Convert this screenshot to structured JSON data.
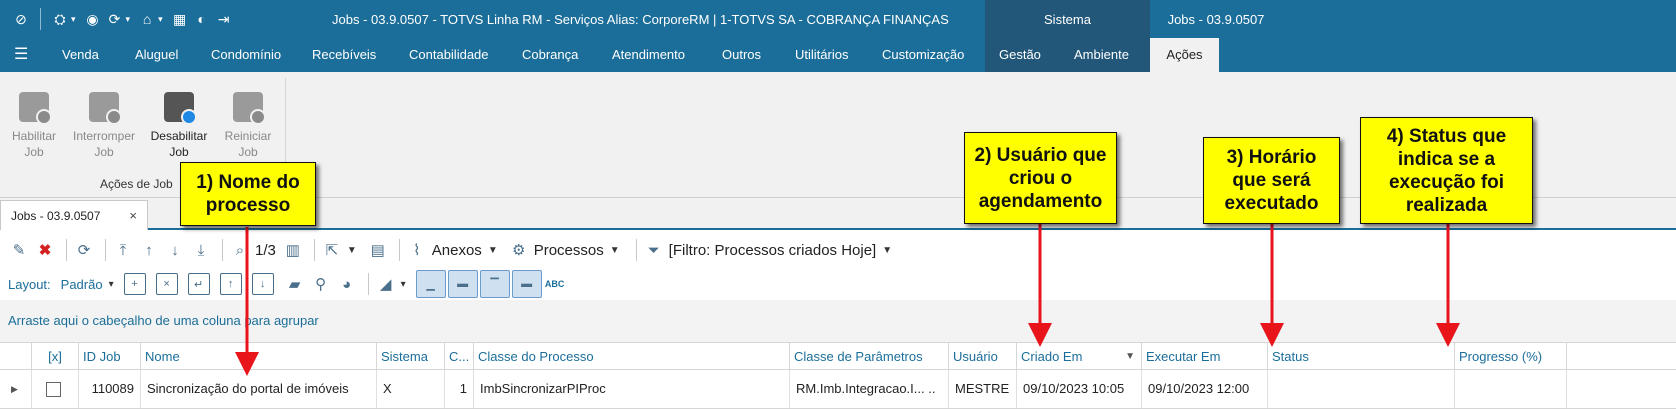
{
  "titlebar": {
    "title": "Jobs - 03.9.0507 - TOTVS Linha RM - Serviços  Alias: CorporeRM | 1-TOTVS SA - COBRANÇA FINANÇAS",
    "ctx_sistema": "Sistema",
    "ctx_jobs": "Jobs - 03.9.0507"
  },
  "menu": {
    "items": [
      "Venda",
      "Aluguel",
      "Condomínio",
      "Recebíveis",
      "Contabilidade",
      "Cobrança",
      "Atendimento",
      "Outros",
      "Utilitários",
      "Customização",
      "Gestão",
      "Ambiente",
      "Ações"
    ]
  },
  "ribbon": {
    "buttons": [
      {
        "line1": "Habilitar",
        "line2": "Job"
      },
      {
        "line1": "Interromper",
        "line2": "Job"
      },
      {
        "line1": "Desabilitar",
        "line2": "Job"
      },
      {
        "line1": "Reiniciar",
        "line2": "Job"
      }
    ],
    "group_label": "Ações de Job"
  },
  "doc_tab": {
    "label": "Jobs - 03.9.0507",
    "close": "×"
  },
  "toolbar": {
    "page": "1/3",
    "anexos": "Anexos",
    "processos": "Processos",
    "filtro": "[Filtro: Processos criados Hoje]"
  },
  "toolbar2": {
    "layout_label": "Layout:",
    "layout_value": "Padrão",
    "abc": "ABC"
  },
  "group_hint": "Arraste aqui o cabeçalho de uma coluna para agrupar",
  "grid": {
    "columns": [
      "[x]",
      "ID Job",
      "Nome",
      "Sistema",
      "C...",
      "Classe do Processo",
      "Classe de Parâmetros",
      "Usuário",
      "Criado Em",
      "Executar Em",
      "Status",
      "Progresso (%)"
    ],
    "row": {
      "id": "110089",
      "nome": "Sincronização do portal de imóveis",
      "sistema": "X",
      "c": "1",
      "classe_processo": "ImbSincronizarPIProc",
      "classe_parametros": "RM.Imb.Integracao.I... ..",
      "usuario": "MESTRE",
      "criado_em": "09/10/2023 10:05",
      "executar_em": "09/10/2023 12:00",
      "status": "",
      "progresso": ""
    }
  },
  "callouts": {
    "c1": [
      "1) Nome do",
      "processo"
    ],
    "c2": [
      "2) Usuário que",
      "criou o",
      "agendamento"
    ],
    "c3": [
      "3) Horário",
      "que será",
      "executado"
    ],
    "c4": [
      "4) Status que",
      "indica se a",
      "execução foi",
      "realizada"
    ]
  },
  "colors": {
    "titlebar": "#1b6e99",
    "context": "#23577a",
    "callout": "#ffff00",
    "arrow": "#e8151b",
    "link": "#1b6e99"
  }
}
